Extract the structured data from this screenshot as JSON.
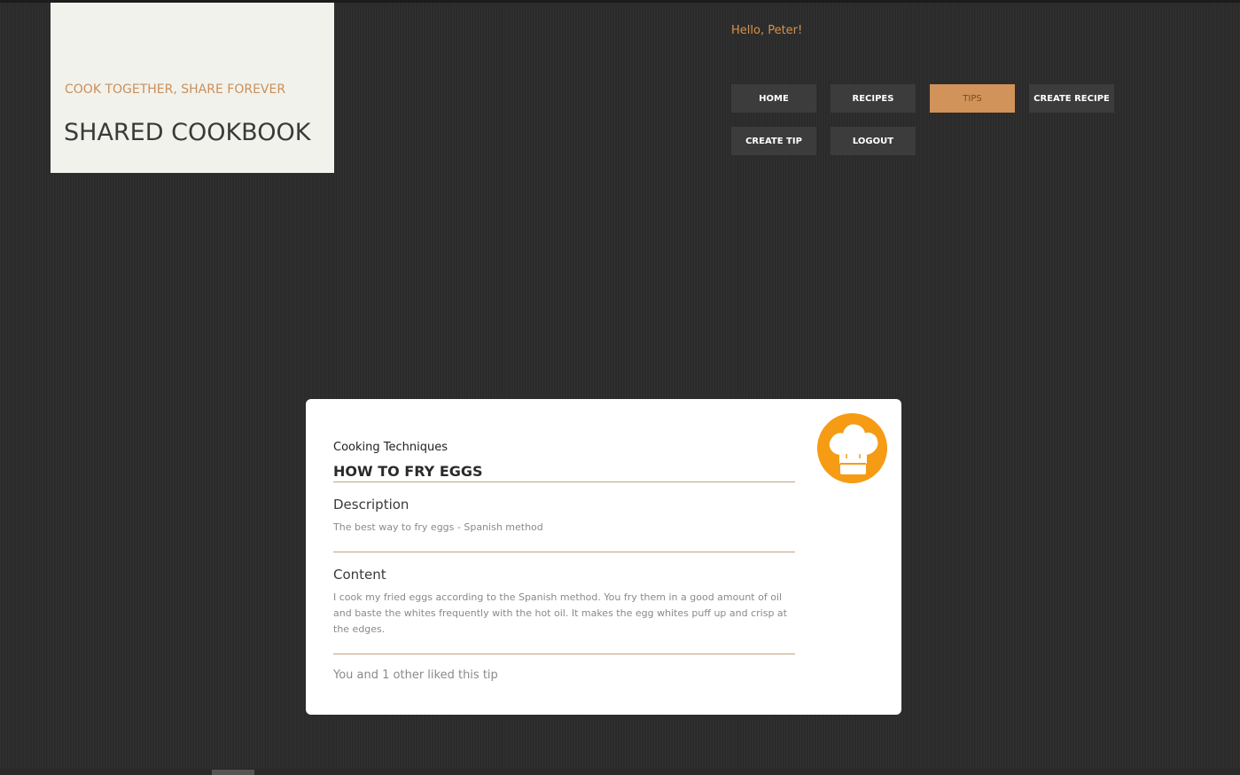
{
  "brand": {
    "tagline": "COOK TOGETHER, SHARE FOREVER",
    "title": "SHARED COOKBOOK"
  },
  "header": {
    "greeting": "Hello, Peter!"
  },
  "nav": {
    "home": "HOME",
    "recipes": "RECIPES",
    "tips": "TIPS",
    "create_recipe": "CREATE RECIPE",
    "create_tip": "CREATE TIP",
    "logout": "LOGOUT",
    "active": "tips"
  },
  "tip": {
    "category": "Cooking Techniques",
    "title": "HOW TO FRY EGGS",
    "description_heading": "Description",
    "description": "The best way to fry eggs - Spanish method",
    "content_heading": "Content",
    "content": "I cook my fried eggs according to the Spanish method. You fry them in a good amount of oil and baste the whites frequently with the hot oil. It makes the egg whites puff up and crisp at the edges.",
    "likes": "You and 1 other liked this tip",
    "icon": "chef-hat-icon"
  },
  "colors": {
    "accent": "#d19359",
    "badge": "#f59c14",
    "background": "#2b2b2b"
  }
}
